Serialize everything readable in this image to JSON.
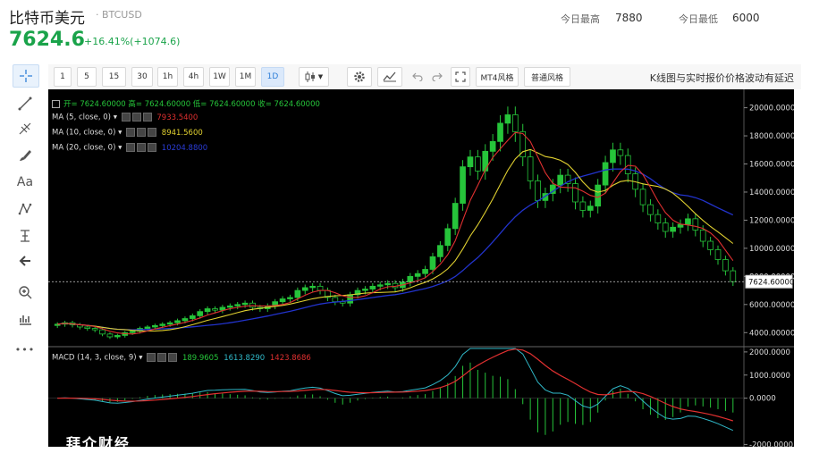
{
  "header": {
    "title": "比特币美元",
    "symbol": "· BTCUSD",
    "price": "7624.6",
    "change": "+16.41%(+1074.6)",
    "high_label": "今日最高",
    "high_value": "7880",
    "low_label": "今日最低",
    "low_value": "6000"
  },
  "toolbar": {
    "intervals": [
      "1",
      "5",
      "15",
      "30",
      "1h",
      "4h",
      "1W",
      "1M",
      "1D"
    ],
    "active_interval": "1D",
    "mt4_label": "MT4风格",
    "normal_label": "普通风格",
    "note": "K线图与实时报价价格波动有延迟"
  },
  "left_tools": [
    "crosshair-icon",
    "trend-line-icon",
    "fib-icon",
    "brush-icon",
    "text-icon",
    "pattern-icon",
    "measure-icon",
    "arrow-left-icon",
    "zoom-icon",
    "bar-chart-icon",
    "more-icon"
  ],
  "left_tool_labels": {
    "text": "Aa",
    "more": "•••"
  },
  "legend": {
    "ohlc": "开= 7624.60000  高= 7624.60000  低= 7624.60000  收= 7624.60000",
    "ma5_label": "MA (5, close, 0)",
    "ma5_value": "7933.5400",
    "ma10_label": "MA (10, close, 0)",
    "ma10_value": "8941.5600",
    "ma20_label": "MA (20, close, 0)",
    "ma20_value": "10204.8800",
    "macd_label": "MACD (14, 3, close, 9)",
    "macd_hist": "189.9605",
    "macd_line": "1613.8290",
    "macd_signal": "1423.8686"
  },
  "watermark": "拜介财经",
  "colors": {
    "up": "#26c43a",
    "ma5": "#e03030",
    "ma10": "#e0d030",
    "ma20": "#2233cc",
    "macd_line": "#30b8c8",
    "macd_signal": "#e03030",
    "price_tag_bg": "#ffffff",
    "accent": "#1aa34a"
  },
  "chart_data": {
    "type": "line",
    "price_axis_ticks": [
      "20000.00000",
      "18000.00000",
      "16000.00000",
      "14000.00000",
      "12000.00000",
      "10000.00000",
      "8000.00000",
      "6000.00000",
      "4000.00000"
    ],
    "price_ylim": [
      3000,
      20800
    ],
    "last_price_label": "7624.60000",
    "last_price": 7624.6,
    "close": [
      4600,
      4700,
      4550,
      4400,
      4300,
      4200,
      3900,
      3700,
      3800,
      4000,
      4100,
      4300,
      4400,
      4500,
      4600,
      4700,
      4850,
      5000,
      5200,
      5500,
      5700,
      5600,
      5800,
      5900,
      6000,
      6100,
      5800,
      5700,
      5900,
      6200,
      6400,
      6500,
      7000,
      7200,
      7300,
      7000,
      6500,
      6200,
      6100,
      6700,
      7000,
      7100,
      7300,
      7400,
      7500,
      7200,
      7600,
      8000,
      8200,
      8500,
      9400,
      10200,
      11400,
      13200,
      15800,
      16500,
      15500,
      16900,
      17600,
      18900,
      19500,
      18300,
      16500,
      14800,
      13400,
      13900,
      14500,
      15200,
      14600,
      13300,
      12700,
      13000,
      14500,
      16100,
      17000,
      16600,
      15300,
      14200,
      13100,
      12400,
      11800,
      11200,
      11500,
      11700,
      12100,
      11300,
      10500,
      9900,
      9200,
      8400,
      7624.6
    ],
    "macd_axis_ticks": [
      "2000.0000",
      "1000.0000",
      "0.0000",
      "-2000.0000"
    ],
    "macd_ylim": [
      -2100,
      2150
    ]
  }
}
